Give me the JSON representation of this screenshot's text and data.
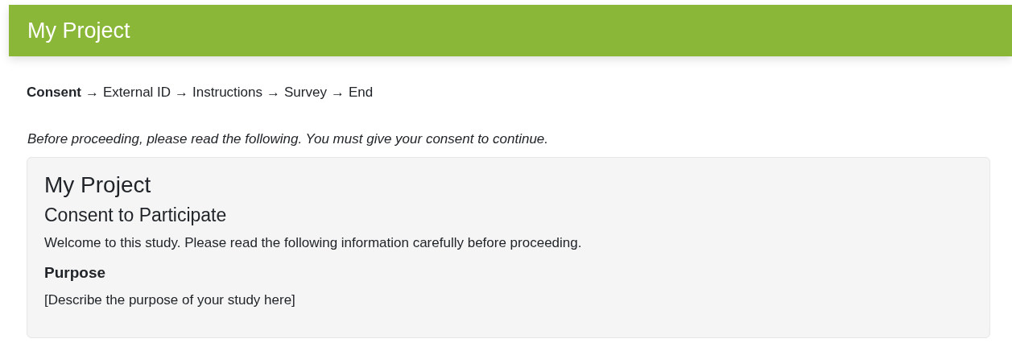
{
  "header": {
    "title": "My Project"
  },
  "breadcrumb": [
    {
      "kind": "step",
      "label": "Consent",
      "selected": true
    },
    {
      "kind": "separator",
      "label": "→"
    },
    {
      "kind": "step",
      "label": "External ID",
      "selected": false
    },
    {
      "kind": "separator",
      "label": "→"
    },
    {
      "kind": "step",
      "label": "Instructions",
      "selected": false
    },
    {
      "kind": "separator",
      "label": "→"
    },
    {
      "kind": "step",
      "label": "Survey",
      "selected": false
    },
    {
      "kind": "separator",
      "label": "→"
    },
    {
      "kind": "step",
      "label": "End",
      "selected": false
    }
  ],
  "notice": "Before proceeding, please read the following. You must give your consent to continue.",
  "consent_card": {
    "title": "My Project",
    "heading": "Consent to Participate",
    "intro": "Welcome to this study. Please read the following information carefully before proceeding.",
    "sections": [
      {
        "heading": "Purpose",
        "body": "[Describe the purpose of your study here]"
      }
    ]
  }
}
